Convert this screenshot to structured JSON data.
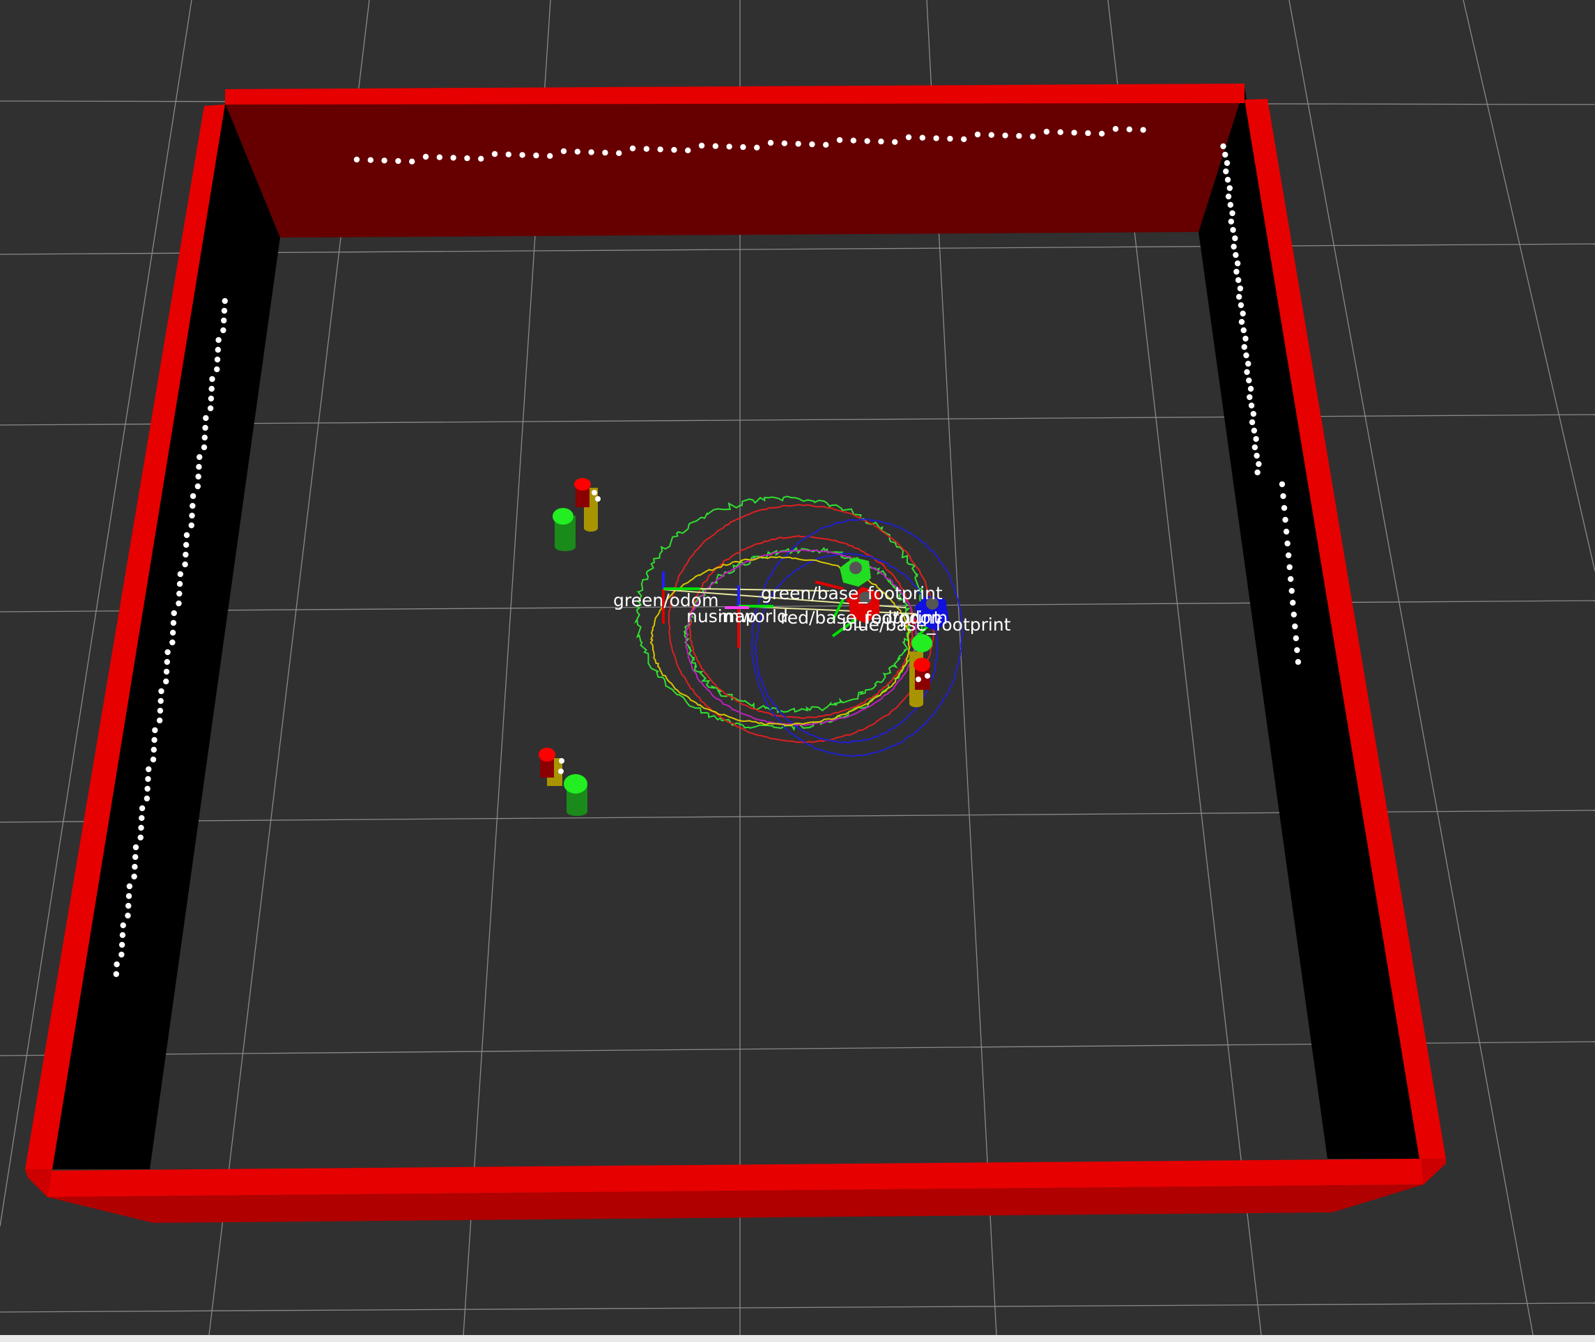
{
  "scene": {
    "background_color": "#303030",
    "grid_color": "#8a8a8a",
    "wall_color": "#e60000",
    "wall_inner_dark": "#660000",
    "wall_side_color": "#000000",
    "laser_point_color": "#ffffff"
  },
  "robots": [
    {
      "name": "green",
      "color": "#22dd22"
    },
    {
      "name": "red",
      "color": "#e00000"
    },
    {
      "name": "blue",
      "color": "#1010e0"
    }
  ],
  "landmarks": [
    {
      "top_color": "#ff0000",
      "body_color": "#c8b400"
    },
    {
      "top_color": "#22ee22",
      "body_color": "#1a8a1a"
    }
  ],
  "tf_frames": {
    "green_odom": "green/odom",
    "green_base": "green/base_footprint",
    "nusim": "nusim",
    "map": "map",
    "world": "world",
    "red_base": "red/base_footprint",
    "red_odom": "red/odom",
    "blue_base": "blue/base_footprint"
  }
}
